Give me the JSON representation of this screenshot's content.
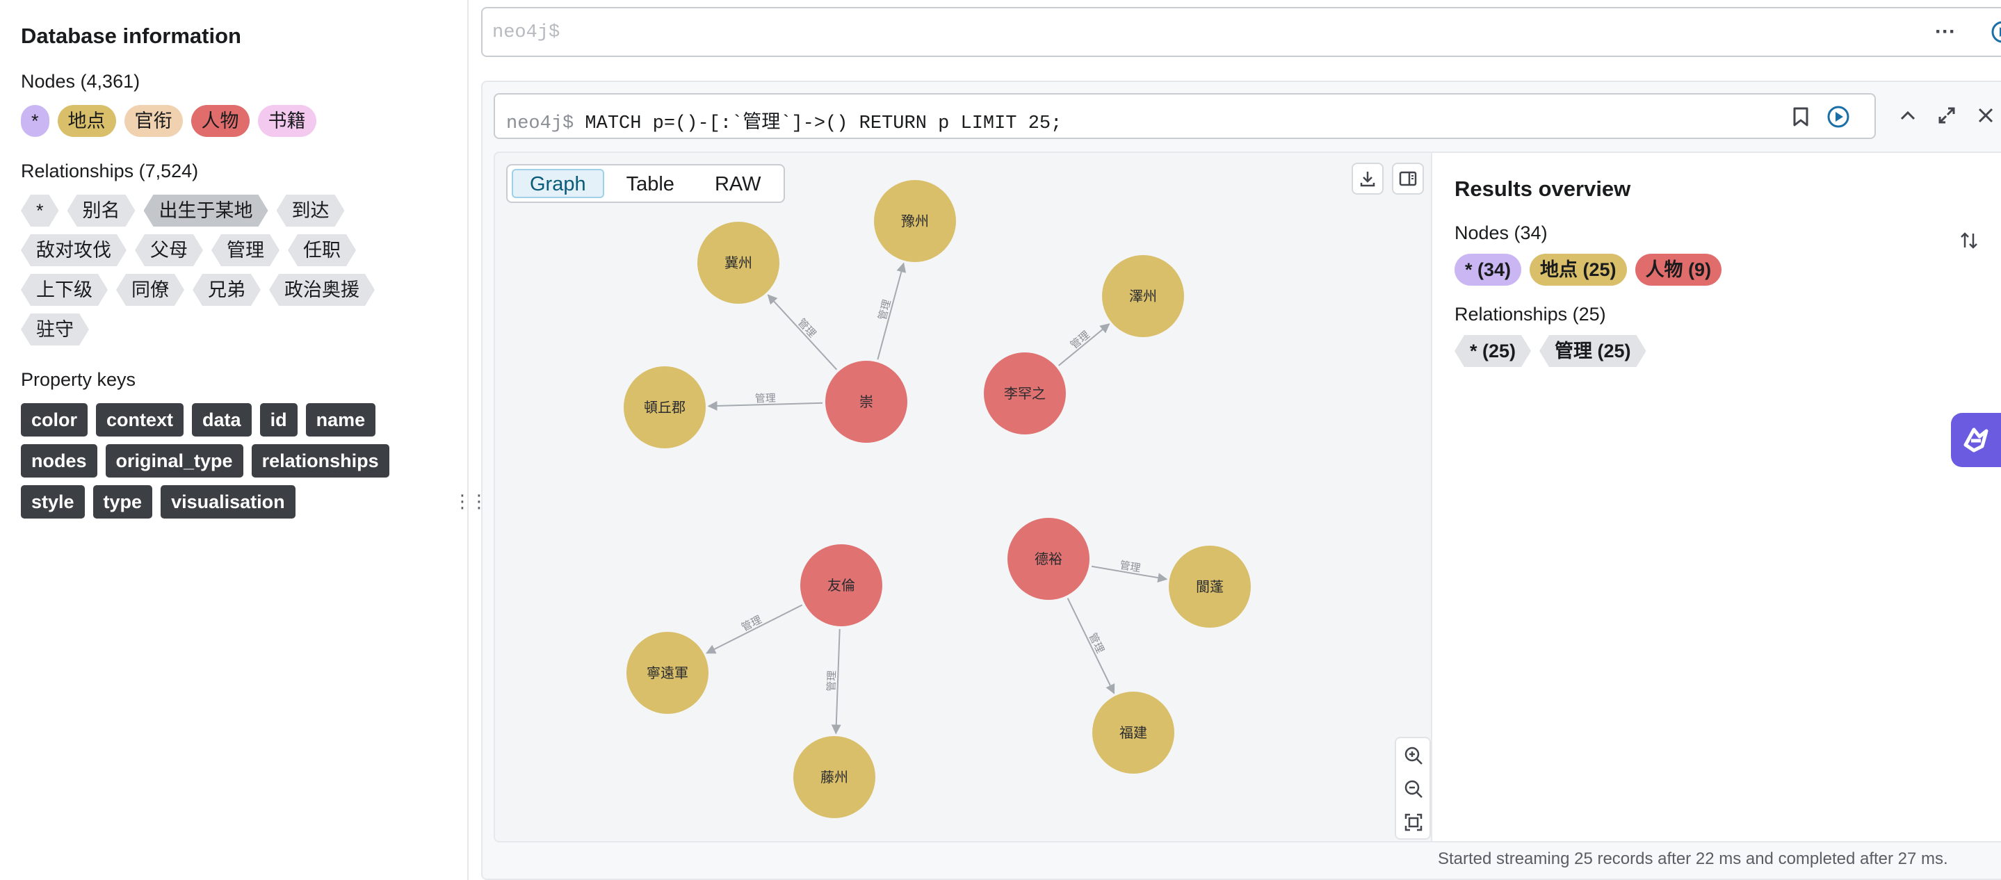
{
  "sidebar": {
    "title": "Database information",
    "nodes_heading": "Nodes (4,361)",
    "node_labels": [
      {
        "label": "*",
        "color": "#c9b6f2"
      },
      {
        "label": "地点",
        "color": "#d9bf6a"
      },
      {
        "label": "官衔",
        "color": "#f0d2b0"
      },
      {
        "label": "人物",
        "color": "#e06c6c"
      },
      {
        "label": "书籍",
        "color": "#f4c9f0"
      }
    ],
    "rels_heading": "Relationships (7,524)",
    "rel_types": [
      "*",
      "别名",
      "出生于某地",
      "到达",
      "敌对攻伐",
      "父母",
      "管理",
      "任职",
      "上下级",
      "同僚",
      "兄弟",
      "政治奥援",
      "驻守"
    ],
    "selected_rel": "出生于某地",
    "props_heading": "Property keys",
    "property_keys": [
      "color",
      "context",
      "data",
      "id",
      "name",
      "nodes",
      "original_type",
      "relationships",
      "style",
      "type",
      "visualisation"
    ]
  },
  "top_editor": {
    "placeholder": "neo4j$"
  },
  "frame": {
    "prompt": "neo4j$",
    "query": " MATCH p=()-[:`管理`]->() RETURN p LIMIT 25;",
    "tabs": [
      "Graph",
      "Table",
      "RAW"
    ],
    "active_tab": "Graph",
    "status": "Started streaming 25 records after 22 ms and completed after 27 ms."
  },
  "graph": {
    "colors": {
      "place": "#d9bf6a",
      "person": "#e07272",
      "edge": "#a5a9b0",
      "edge_label": "#8b8f96"
    },
    "nodes": [
      {
        "id": "n1",
        "name": "冀州",
        "kind": "place"
      },
      {
        "id": "n2",
        "name": "豫州",
        "kind": "place"
      },
      {
        "id": "n3",
        "name": "崇",
        "kind": "person"
      },
      {
        "id": "n4",
        "name": "頓丘郡",
        "kind": "place"
      },
      {
        "id": "n5",
        "name": "澤州",
        "kind": "place"
      },
      {
        "id": "n6",
        "name": "李罕之",
        "kind": "person"
      },
      {
        "id": "n7",
        "name": "友倫",
        "kind": "person"
      },
      {
        "id": "n8",
        "name": "寧遠軍",
        "kind": "place"
      },
      {
        "id": "n9",
        "name": "藤州",
        "kind": "place"
      },
      {
        "id": "n10",
        "name": "德裕",
        "kind": "person"
      },
      {
        "id": "n11",
        "name": "閬蓬",
        "kind": "place"
      },
      {
        "id": "n12",
        "name": "福建",
        "kind": "place"
      }
    ],
    "edges": [
      {
        "from": "n3",
        "to": "n1",
        "label": "管理"
      },
      {
        "from": "n3",
        "to": "n2",
        "label": "管理"
      },
      {
        "from": "n3",
        "to": "n4",
        "label": "管理"
      },
      {
        "from": "n6",
        "to": "n5",
        "label": "管理"
      },
      {
        "from": "n7",
        "to": "n8",
        "label": "管理"
      },
      {
        "from": "n7",
        "to": "n9",
        "label": "管理"
      },
      {
        "from": "n10",
        "to": "n11",
        "label": "管理"
      },
      {
        "from": "n10",
        "to": "n12",
        "label": "管理"
      }
    ]
  },
  "overview": {
    "title": "Results overview",
    "nodes_heading": "Nodes (34)",
    "node_chips": [
      {
        "label": "* (34)",
        "color": "#c9b6f2"
      },
      {
        "label": "地点 (25)",
        "color": "#d9bf6a"
      },
      {
        "label": "人物 (9)",
        "color": "#e06c6c"
      }
    ],
    "rels_heading": "Relationships (25)",
    "rel_chips": [
      "* (25)",
      "管理 (25)"
    ]
  }
}
